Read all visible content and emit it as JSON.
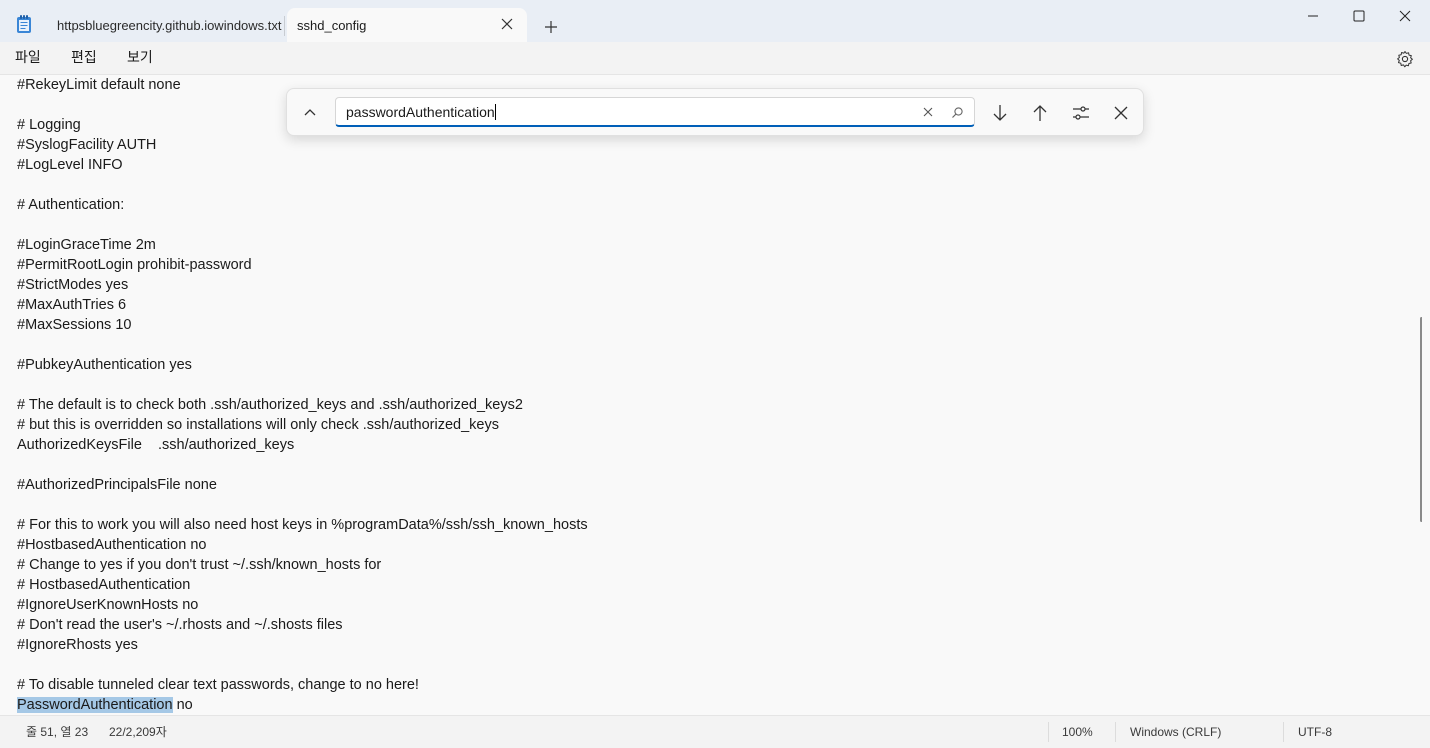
{
  "window": {
    "tabs": [
      {
        "label": "httpsbluegreencity.github.iowindows.txt",
        "active": false
      },
      {
        "label": "sshd_config",
        "active": true
      }
    ]
  },
  "menu": {
    "items": [
      "파일",
      "편집",
      "보기"
    ]
  },
  "find": {
    "query": "passwordAuthentication"
  },
  "editor": {
    "lines": [
      "#RekeyLimit default none",
      "",
      "# Logging",
      "#SyslogFacility AUTH",
      "#LogLevel INFO",
      "",
      "# Authentication:",
      "",
      "#LoginGraceTime 2m",
      "#PermitRootLogin prohibit-password",
      "#StrictModes yes",
      "#MaxAuthTries 6",
      "#MaxSessions 10",
      "",
      "#PubkeyAuthentication yes",
      "",
      "# The default is to check both .ssh/authorized_keys and .ssh/authorized_keys2",
      "# but this is overridden so installations will only check .ssh/authorized_keys",
      "AuthorizedKeysFile\t.ssh/authorized_keys",
      "",
      "#AuthorizedPrincipalsFile none",
      "",
      "# For this to work you will also need host keys in %programData%/ssh/ssh_known_hosts",
      "#HostbasedAuthentication no",
      "# Change to yes if you don't trust ~/.ssh/known_hosts for",
      "# HostbasedAuthentication",
      "#IgnoreUserKnownHosts no",
      "# Don't read the user's ~/.rhosts and ~/.shosts files",
      "#IgnoreRhosts yes",
      "",
      "# To disable tunneled clear text passwords, change to no here!"
    ],
    "match_line": {
      "highlighted": "PasswordAuthentication",
      "rest": " no"
    }
  },
  "status": {
    "position": "줄 51, 열 23",
    "selection": "22/2,209자",
    "zoom": "100%",
    "line_ending": "Windows (CRLF)",
    "encoding": "UTF-8"
  },
  "colors": {
    "highlight": "#a5c8e6",
    "accent": "#005fb8"
  }
}
